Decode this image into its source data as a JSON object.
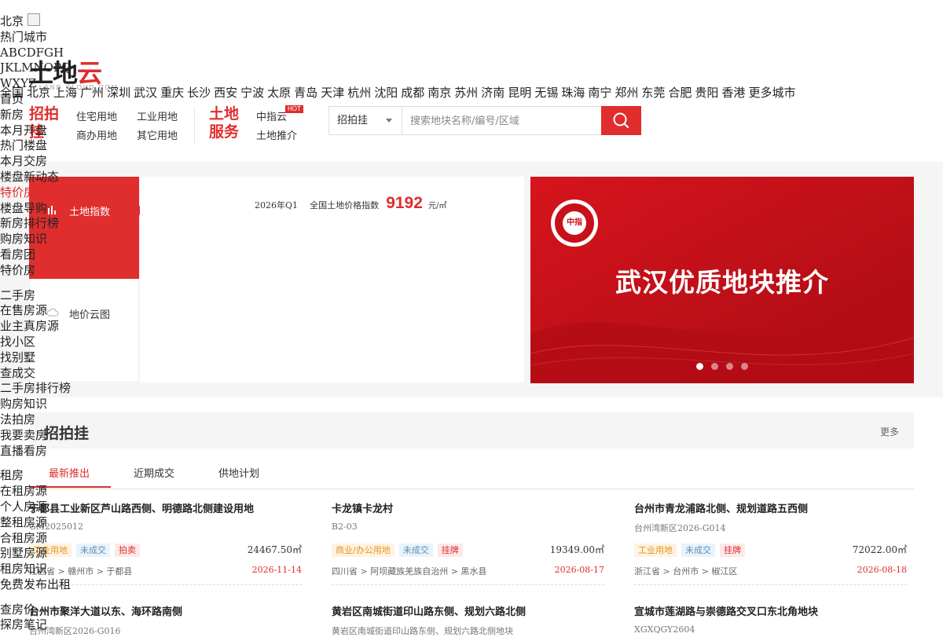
{
  "leftnav": {
    "city": "北京",
    "hot_city_label": "热门城市",
    "letters": [
      "ABCDFGH",
      "JKLMNOPQ",
      "WXYZ"
    ],
    "groups": [
      {
        "items": [
          "首页",
          "新房",
          "本月开盘",
          "热门楼盘",
          "本月交房",
          "楼盘新动态",
          "特价房",
          "楼盘导购",
          "新房排行榜",
          "购房知识",
          "看房团",
          "特价房"
        ]
      },
      {
        "items": [
          "二手房",
          "在售房源",
          "业主真房源",
          "找小区",
          "找别墅",
          "查成交",
          "二手房排行榜",
          "购房知识",
          "法拍房",
          "我要卖房",
          "直播看房"
        ]
      },
      {
        "items": [
          "租房",
          "在租房源",
          "个人房源",
          "整租房源",
          "合租房源",
          "别墅房源",
          "租房知识",
          "免费发布出租"
        ]
      },
      {
        "items": [
          "查房价",
          "探房笔记"
        ]
      }
    ],
    "hot_item": "特价房"
  },
  "logo": {
    "part1": "土地",
    "part2": "云",
    "sub": "LAND CLOUD.COM"
  },
  "cities": [
    "全国",
    "北京",
    "上海",
    "广州",
    "深圳",
    "武汉",
    "重庆",
    "长沙",
    "西安",
    "宁波",
    "太原",
    "青岛",
    "天津",
    "杭州",
    "沈阳",
    "成都",
    "南京",
    "苏州",
    "济南",
    "昆明",
    "无锡",
    "珠海",
    "南宁",
    "郑州",
    "东莞",
    "合肥",
    "贵阳",
    "香港",
    "更多城市"
  ],
  "menus": {
    "zhaopaigua": {
      "title1": "招拍",
      "title2": "挂",
      "items": [
        "住宅用地",
        "工业用地",
        "商办用地",
        "其它用地"
      ]
    },
    "service": {
      "title1": "土地",
      "title2": "服务",
      "items": [
        "中指云",
        "土地推介"
      ],
      "hot": "HOT"
    }
  },
  "search": {
    "select_value": "招拍挂",
    "placeholder": "搜索地块名称/编号/区域"
  },
  "index_panel": {
    "tabs": [
      {
        "label": "土地指数",
        "icon": "bar-chart-icon"
      },
      {
        "label": "地价云图",
        "icon": "cloud-icon"
      }
    ],
    "period": "2026年Q1",
    "index_label": "全国土地价格指数",
    "index_value": "9192",
    "unit": "元/㎡"
  },
  "banner": {
    "title": "武汉优质地块推介",
    "seal_char": "中指",
    "seal_ring": "CHINA INDEX ACADEMY",
    "seal_bottom": "研究院",
    "dots": 4,
    "active_dot": 0
  },
  "section": {
    "title": "招拍挂",
    "more": "更多",
    "tabs": [
      "最新推出",
      "近期成交",
      "供地计划"
    ],
    "active_tab": 0,
    "cards": [
      {
        "name": "于都县工业新区芦山路西侧、明德路北侧建设用地",
        "code": "GM2025012",
        "tags": [
          {
            "text": "工业用地",
            "kind": "ind"
          },
          {
            "text": "未成交",
            "kind": "st"
          },
          {
            "text": "拍卖",
            "kind": "md"
          }
        ],
        "area": "24467.50㎡",
        "loc": "江西省 > 赣州市 > 于都县",
        "date": "2026-11-14"
      },
      {
        "name": "卡龙镇卡龙村",
        "code": "B2-03",
        "tags": [
          {
            "text": "商业/办公用地",
            "kind": "biz"
          },
          {
            "text": "未成交",
            "kind": "st"
          },
          {
            "text": "挂牌",
            "kind": "md"
          }
        ],
        "area": "19349.00㎡",
        "loc": "四川省 > 阿坝藏族羌族自治州 > 黑水县",
        "date": "2026-08-17"
      },
      {
        "name": "台州市青龙浦路北侧、规划道路五西侧",
        "code": "台州湾新区2026-G014",
        "tags": [
          {
            "text": "工业用地",
            "kind": "ind"
          },
          {
            "text": "未成交",
            "kind": "st"
          },
          {
            "text": "挂牌",
            "kind": "md"
          }
        ],
        "area": "72022.00㎡",
        "loc": "浙江省 > 台州市 > 椒江区",
        "date": "2026-08-18"
      },
      {
        "name": "台州市聚洋大道以东、海环路南侧",
        "code": "台州湾新区2026-G016"
      },
      {
        "name": "黄岩区南城街道印山路东侧、规划六路北侧",
        "code": "黄岩区南城街道印山路东侧、规划六路北侧地块"
      },
      {
        "name": "宣城市莲湖路与崇德路交叉口东北角地块",
        "code": "XGXQGY2604"
      }
    ]
  },
  "colors": {
    "accent": "#e02d2d",
    "band": "#f5f5f5"
  }
}
